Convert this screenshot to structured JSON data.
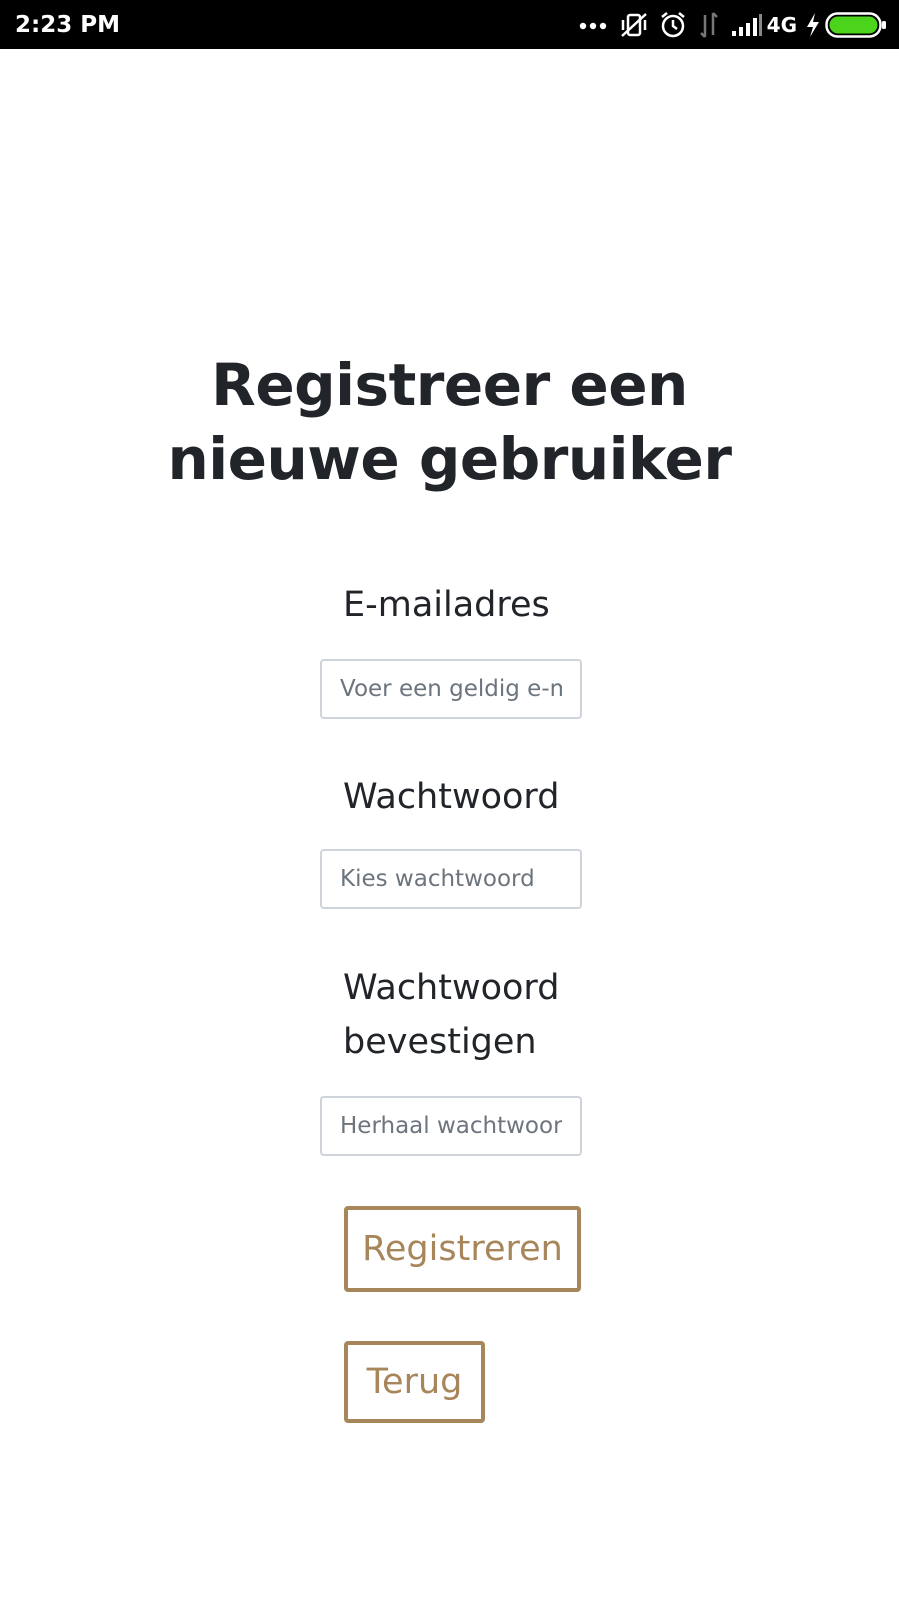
{
  "status_bar": {
    "time": "2:23 PM",
    "network": "4G",
    "icons": [
      "more-dots-icon",
      "vibrate-off-icon",
      "alarm-icon",
      "data-transfer-icon",
      "signal-icon",
      "charging-icon",
      "battery-icon"
    ],
    "battery_color": "#4cd31c"
  },
  "form": {
    "title_line1": "Registreer een",
    "title_line2": "nieuwe gebruiker",
    "email_label": "E-mailadres",
    "email_placeholder": "Voer een geldig e-mailadres in",
    "password_label": "Wachtwoord",
    "password_placeholder": "Kies wachtwoord",
    "confirm_label_line1": "Wachtwoord",
    "confirm_label_line2": "bevestigen",
    "confirm_placeholder": "Herhaal wachtwoord",
    "register_button": "Registreren",
    "back_button": "Terug"
  },
  "colors": {
    "accent": "#a8865b",
    "text": "#212529",
    "input_border": "#ced4da"
  }
}
